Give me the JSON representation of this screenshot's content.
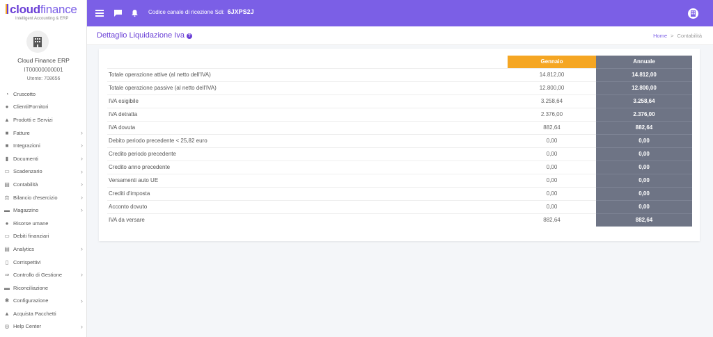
{
  "brand": {
    "name_bold": "cloud",
    "name_thin": "finance",
    "tagline": "Intelligent Accounting & ERP"
  },
  "topbar": {
    "channel_label": "Codice canale di ricezione Sdi:",
    "channel_code": "6JXPS2J"
  },
  "company": {
    "name": "Cloud Finance ERP",
    "vat": "IT00000000001",
    "user": "Utente: 708656"
  },
  "sidebar": {
    "items": [
      {
        "label": "Cruscotto",
        "icon": "dashboard-icon",
        "chevron": false
      },
      {
        "label": "Clienti/Fornitori",
        "icon": "user-icon",
        "chevron": false
      },
      {
        "label": "Prodotti e Servizi",
        "icon": "basket-icon",
        "chevron": false
      },
      {
        "label": "Fatture",
        "icon": "file-icon",
        "chevron": true
      },
      {
        "label": "Integrazioni",
        "icon": "file-icon",
        "chevron": true
      },
      {
        "label": "Documenti",
        "icon": "documents-icon",
        "chevron": true
      },
      {
        "label": "Scadenzario",
        "icon": "calendar-icon",
        "chevron": true
      },
      {
        "label": "Contabilità",
        "icon": "book-icon",
        "chevron": true
      },
      {
        "label": "Bilancio d'esercizio",
        "icon": "balance-icon",
        "chevron": true
      },
      {
        "label": "Magazzino",
        "icon": "warehouse-icon",
        "chevron": true
      },
      {
        "label": "Risorse umane",
        "icon": "user-icon",
        "chevron": false
      },
      {
        "label": "Debiti finanziari",
        "icon": "money-icon",
        "chevron": false
      },
      {
        "label": "Analytics",
        "icon": "book-icon",
        "chevron": true
      },
      {
        "label": "Corrispettivi",
        "icon": "receipt-icon",
        "chevron": false
      },
      {
        "label": "Controllo di Gestione",
        "icon": "arrow-icon",
        "chevron": true
      },
      {
        "label": "Riconciliazione",
        "icon": "bank-icon",
        "chevron": false
      },
      {
        "label": "Configurazione",
        "icon": "gear-icon",
        "chevron": true
      },
      {
        "label": "Acquista Pacchetti",
        "icon": "basket-icon",
        "chevron": false
      },
      {
        "label": "Help Center",
        "icon": "globe-icon",
        "chevron": true
      }
    ]
  },
  "page": {
    "title": "Dettaglio Liquidazione Iva",
    "breadcrumb": {
      "home": "Home",
      "separator": ">",
      "current": "Contabilità"
    }
  },
  "table": {
    "headers": {
      "month": "Gennaio",
      "annual": "Annuale"
    },
    "rows": [
      {
        "label": "Totale operazione attive (al netto dell'IVA)",
        "month": "14.812,00",
        "annual": "14.812,00"
      },
      {
        "label": "Totale operazione passive (al netto dell'IVA)",
        "month": "12.800,00",
        "annual": "12.800,00"
      },
      {
        "label": "IVA esigibile",
        "month": "3.258,64",
        "annual": "3.258,64"
      },
      {
        "label": "IVA detratta",
        "month": "2.376,00",
        "annual": "2.376,00"
      },
      {
        "label": "IVA dovuta",
        "month": "882,64",
        "annual": "882,64"
      },
      {
        "label": "Debito periodo precedente < 25,82 euro",
        "month": "0,00",
        "annual": "0,00"
      },
      {
        "label": "Credito periodo precedente",
        "month": "0,00",
        "annual": "0,00"
      },
      {
        "label": "Credito anno precedente",
        "month": "0,00",
        "annual": "0,00"
      },
      {
        "label": "Versamenti auto UE",
        "month": "0,00",
        "annual": "0,00"
      },
      {
        "label": "Crediti d'imposta",
        "month": "0,00",
        "annual": "0,00"
      },
      {
        "label": "Acconto dovuto",
        "month": "0,00",
        "annual": "0,00"
      },
      {
        "label": "IVA da versare",
        "month": "882,64",
        "annual": "882,64"
      }
    ]
  },
  "colors": {
    "accent": "#7b5fe6",
    "month_header": "#f5a623",
    "annual_column": "#6e7485"
  }
}
